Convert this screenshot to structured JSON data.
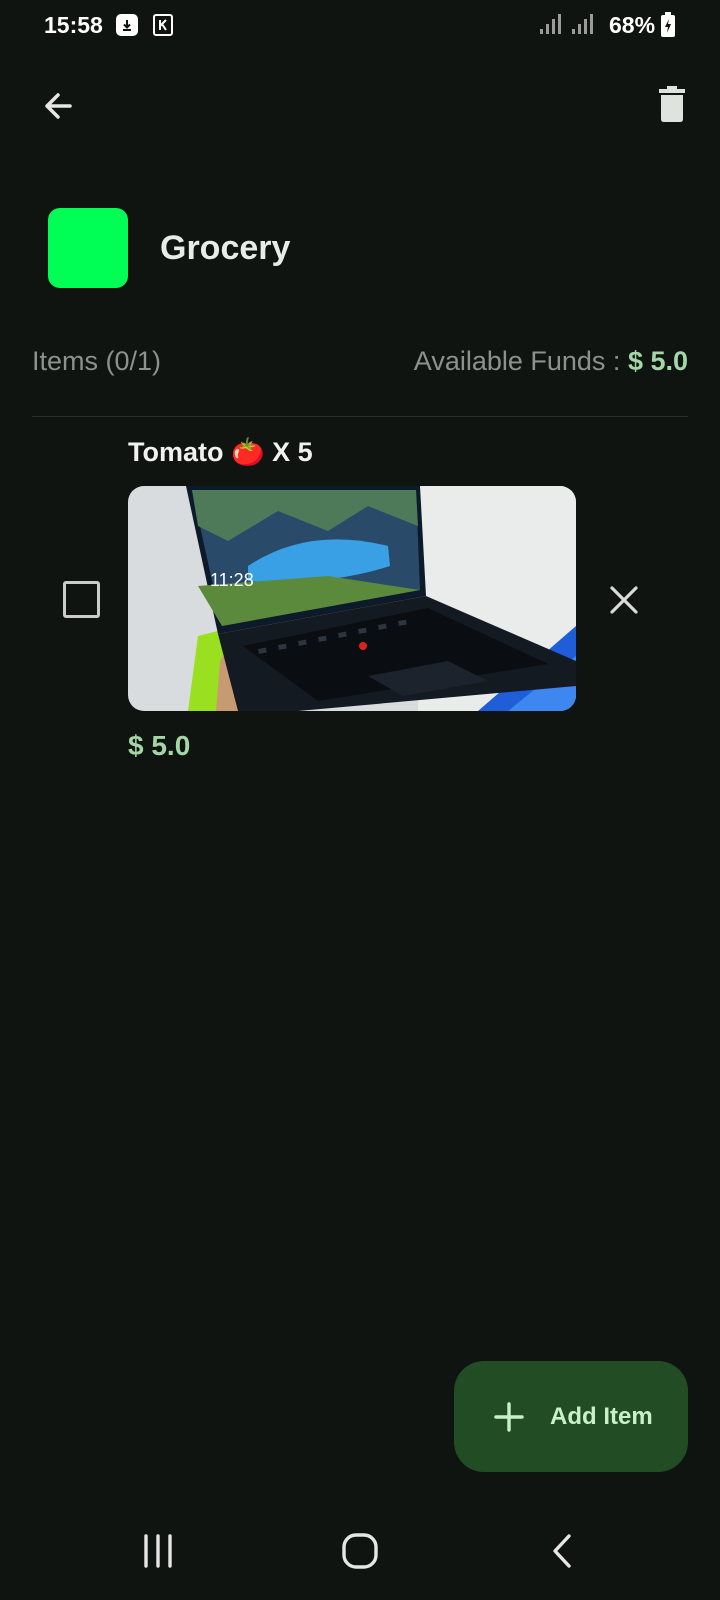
{
  "status_bar": {
    "time": "15:58",
    "battery": "68%",
    "icons": [
      "download-icon",
      "k-app-icon",
      "signal-icon",
      "signal-icon",
      "battery-charging-icon"
    ]
  },
  "app_bar": {
    "back_icon": "arrow-back-icon",
    "delete_icon": "trash-icon"
  },
  "list": {
    "title": "Grocery",
    "color": "#00ff55",
    "items_count": "Items (0/1)",
    "funds_label": "Available Funds : ",
    "funds_value": "$ 5.0"
  },
  "items": [
    {
      "title": "Tomato 🍅 X 5",
      "checked": false,
      "image": "photo of a laptop",
      "price": "$ 5.0"
    }
  ],
  "fab": {
    "label": "Add Item",
    "icon": "plus-icon"
  },
  "nav_bar": {
    "icons": [
      "recent-apps-icon",
      "home-icon",
      "back-icon"
    ]
  },
  "colors": {
    "background": "#101410",
    "accent_green": "#a5d6a7",
    "fab_background": "#224d24"
  }
}
